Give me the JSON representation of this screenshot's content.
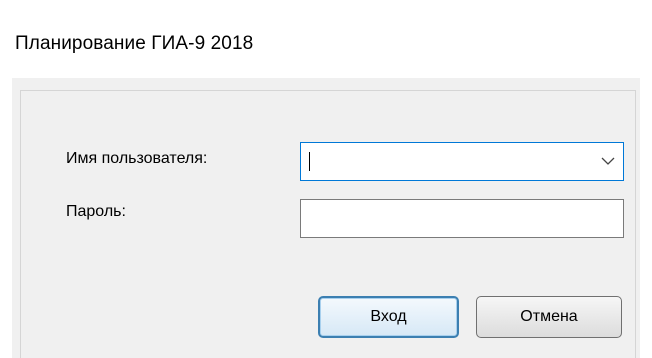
{
  "window": {
    "title": "Планирование ГИА-9 2018"
  },
  "form": {
    "username_label": "Имя пользователя:",
    "username_value": "",
    "password_label": "Пароль:",
    "password_value": ""
  },
  "buttons": {
    "login_label": "Вход",
    "cancel_label": "Отмена"
  },
  "icons": {
    "dropdown": "chevron-down-icon"
  },
  "colors": {
    "focus_border": "#0078d7",
    "default_button_border": "#3c7fb1",
    "client_background": "#f0f0f0"
  }
}
